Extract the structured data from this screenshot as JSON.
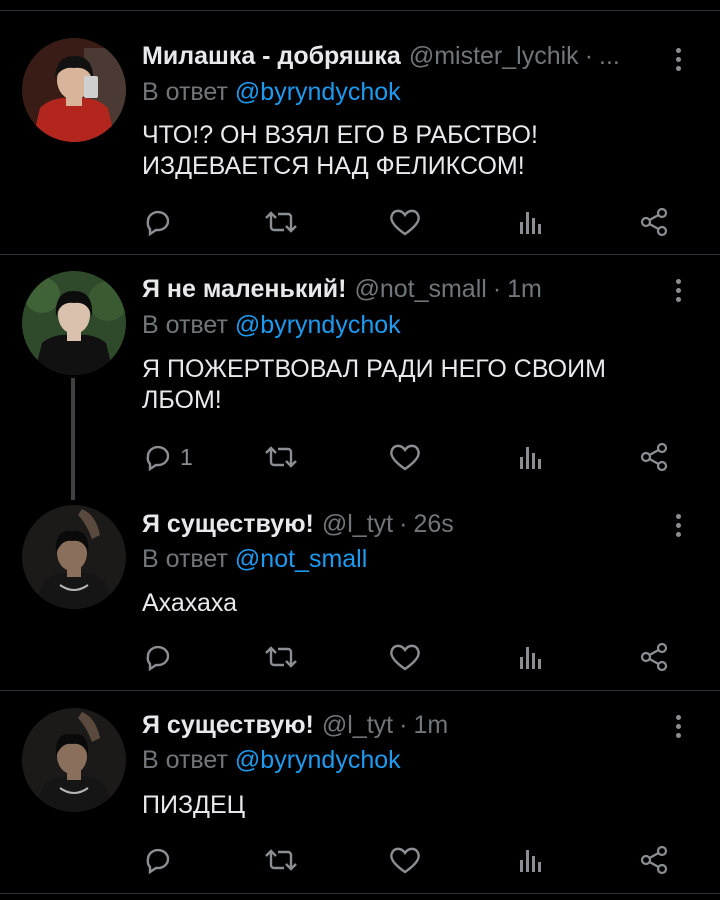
{
  "tweets": [
    {
      "name": "Милашка - добряшка",
      "handle": "@mister_lychik",
      "dot": "·",
      "time": "...",
      "reply_prefix": "В ответ",
      "reply_mention": "@byryndychok",
      "text": "ЧТО!? ОН ВЗЯЛ ЕГО В РАБСТВО! ИЗДЕВАЕТСЯ НАД ФЕЛИКСОМ!",
      "reply_count": "",
      "avatar_colors": {
        "bg": "#3a1c16",
        "clothes": "#b3261e",
        "skin": "#d8b49a",
        "hair": "#111111"
      }
    },
    {
      "name": "Я не маленький!",
      "handle": "@not_small",
      "dot": "·",
      "time": "1m",
      "reply_prefix": "В ответ",
      "reply_mention": "@byryndychok",
      "text": "Я ПОЖЕРТВОВАЛ РАДИ НЕГО СВОИМ ЛБОМ!",
      "reply_count": "1",
      "avatar_colors": {
        "bg": "#2f4a2a",
        "clothes": "#111111",
        "skin": "#d9c1ad",
        "hair": "#0c0c0c"
      }
    },
    {
      "name": "Я существую!",
      "handle": "@l_tyt",
      "dot": "·",
      "time": "26s",
      "reply_prefix": "В ответ",
      "reply_mention": "@not_small",
      "text": "Ахахаха",
      "reply_count": "",
      "avatar_colors": {
        "bg": "#1c1a18",
        "clothes": "#151515",
        "skin": "#8a6f5c",
        "hair": "#0a0a0a"
      }
    },
    {
      "name": "Я существую!",
      "handle": "@l_tyt",
      "dot": "·",
      "time": "1m",
      "reply_prefix": "В ответ",
      "reply_mention": "@byryndychok",
      "text": "ПИЗДЕЦ",
      "reply_count": "",
      "avatar_colors": {
        "bg": "#1c1a18",
        "clothes": "#151515",
        "skin": "#8a6f5c",
        "hair": "#0a0a0a"
      }
    }
  ],
  "icons": {
    "reply": "reply-icon",
    "retweet": "retweet-icon",
    "like": "heart-icon",
    "views": "views-icon",
    "share": "share-icon",
    "menu": "more-icon"
  },
  "colors": {
    "background": "#000000",
    "text": "#e7e9ea",
    "muted": "#71767b",
    "mention": "#1d9bf0",
    "divider": "#2f3336"
  }
}
